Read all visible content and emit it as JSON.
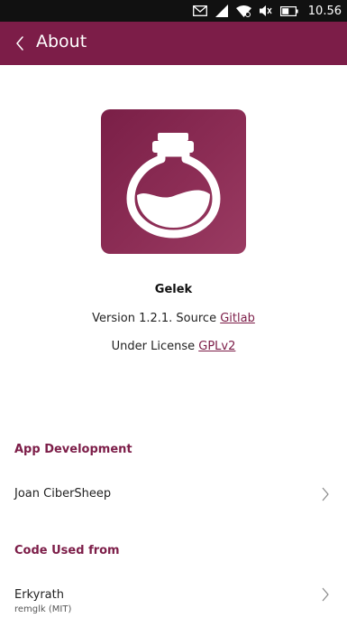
{
  "status_bar": {
    "time": "10.56",
    "icons": [
      "mail-icon",
      "cellular-signal-icon",
      "wifi-icon",
      "volume-muted-icon",
      "battery-icon"
    ]
  },
  "header": {
    "title": "About"
  },
  "app": {
    "name": "Gelek",
    "version_prefix": "Version 1.2.1. Source",
    "source_link": "Gitlab",
    "license_prefix": "Under License",
    "license_link": "GPLv2"
  },
  "sections": {
    "development": {
      "title": "App Development",
      "items": [
        {
          "name": "Joan CiberSheep"
        }
      ]
    },
    "code_used": {
      "title": "Code Used from",
      "items": [
        {
          "name": "Erkyrath",
          "detail": "remglk (MIT)"
        }
      ]
    }
  },
  "colors": {
    "accent": "#7c1d48",
    "statusbar": "#111111",
    "background": "#ffffff"
  }
}
